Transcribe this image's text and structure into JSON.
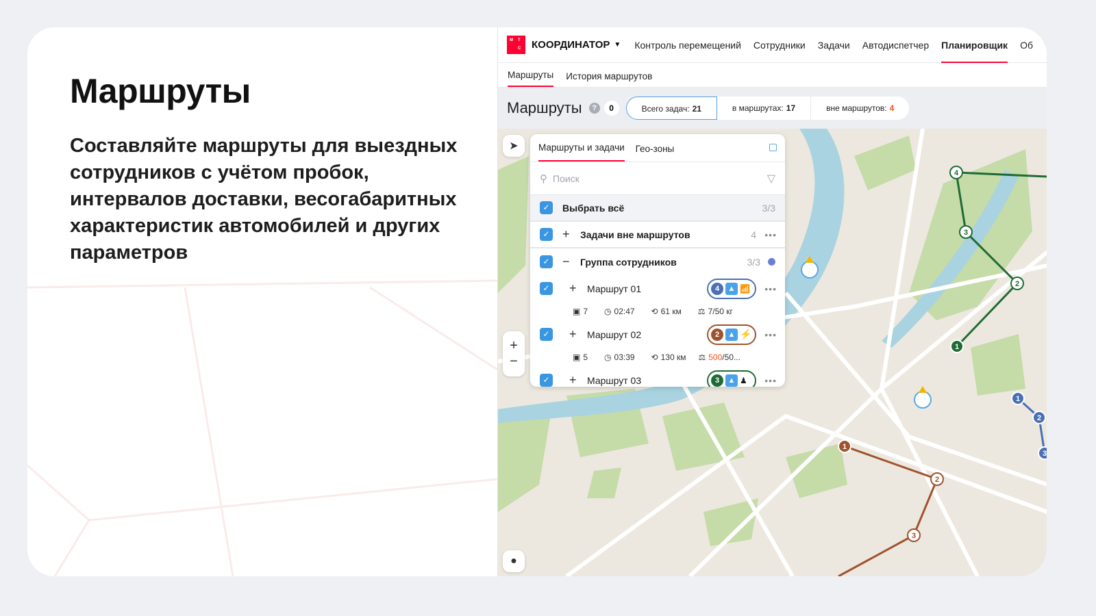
{
  "hero": {
    "title": "Маршруты",
    "description": "Составляйте маршруты для выездных сотрудников с учётом пробок, интервалов доставки, весогабаритных характеристик автомобилей и других параметров"
  },
  "app": {
    "logo": "МТС",
    "brand": "КООРДИНАТОР",
    "nav": [
      "Контроль перемещений",
      "Сотрудники",
      "Задачи",
      "Автодиспетчер",
      "Планировщик",
      "Об"
    ],
    "subnav": [
      "Маршруты",
      "История маршрутов"
    ],
    "header": {
      "title": "Маршруты",
      "help": "?",
      "count": "0"
    },
    "stats": [
      {
        "label": "Всего задач:",
        "value": "21"
      },
      {
        "label": "в маршрутах:",
        "value": "17"
      },
      {
        "label": "вне маршрутов:",
        "value": "4"
      }
    ],
    "panel": {
      "tabs": [
        "Маршруты и задачи",
        "Гео-зоны"
      ],
      "search_placeholder": "Поиск",
      "select_all": {
        "label": "Выбрать всё",
        "count": "3/3"
      },
      "unrouted": {
        "label": "Задачи вне маршрутов",
        "count": "4"
      },
      "group": {
        "label": "Группа сотрудников",
        "count": "3/3"
      },
      "routes": [
        {
          "name": "Маршрут 01",
          "badge": "4",
          "color": "#4a6fb5",
          "tasks": "7",
          "time": "02:47",
          "distance": "61 км",
          "weight": "7/50 кг",
          "weight_over": ""
        },
        {
          "name": "Маршрут 02",
          "badge": "2",
          "color": "#a0522d",
          "tasks": "5",
          "time": "03:39",
          "distance": "130 км",
          "weight": "/50...",
          "weight_over": "500"
        },
        {
          "name": "Маршрут 03",
          "badge": "3",
          "color": "#1e6b34"
        }
      ]
    },
    "map": {
      "green_points": [
        "1",
        "2",
        "3",
        "4"
      ],
      "brown_points": [
        "1",
        "2",
        "3"
      ],
      "blue_points": [
        "1",
        "2",
        "3"
      ]
    }
  },
  "colors": {
    "accent": "#ff0032",
    "check": "#3a96e0",
    "over": "#f4511e"
  }
}
